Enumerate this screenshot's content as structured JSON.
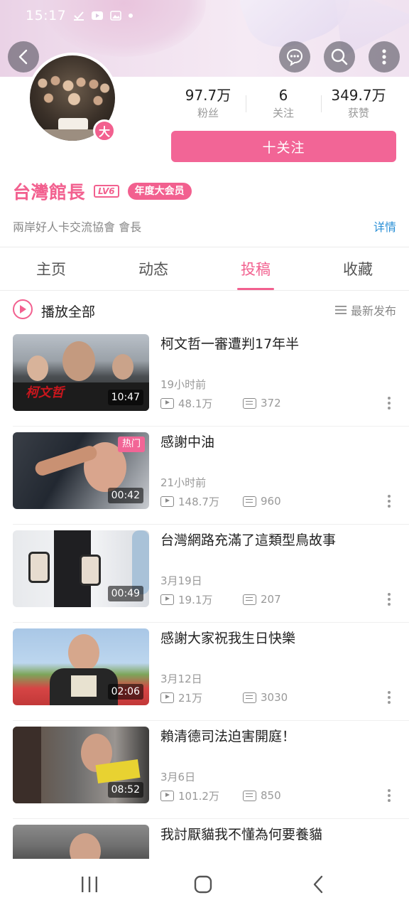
{
  "status_bar": {
    "time": "15:17"
  },
  "header": {
    "back_icon": "chevron-left-icon",
    "actions": [
      "chat-bubble-icon",
      "search-icon",
      "more-vertical-icon"
    ]
  },
  "profile": {
    "badge": "大",
    "name": "台灣館長",
    "level": "LV6",
    "vip_label": "年度大会员",
    "bio": "兩岸好人卡交流協會 會長",
    "detail_link": "详情",
    "follow_button": "十关注",
    "stats": [
      {
        "value": "97.7万",
        "label": "粉丝"
      },
      {
        "value": "6",
        "label": "关注"
      },
      {
        "value": "349.7万",
        "label": "获赞"
      }
    ]
  },
  "tabs": [
    {
      "label": "主页",
      "active": false
    },
    {
      "label": "动态",
      "active": false
    },
    {
      "label": "投稿",
      "active": true
    },
    {
      "label": "收藏",
      "active": false
    }
  ],
  "list_header": {
    "play_all": "播放全部",
    "sort": "最新发布"
  },
  "videos": [
    {
      "title": "柯文哲一審遭判17年半",
      "duration": "10:47",
      "date": "19小时前",
      "views": "48.1万",
      "comments": "372",
      "hot": ""
    },
    {
      "title": "感謝中油",
      "duration": "00:42",
      "date": "21小时前",
      "views": "148.7万",
      "comments": "960",
      "hot": "热门"
    },
    {
      "title": "台灣網路充滿了這類型鳥故事",
      "duration": "00:49",
      "date": "3月19日",
      "views": "19.1万",
      "comments": "207",
      "hot": ""
    },
    {
      "title": "感謝大家祝我生日快樂",
      "duration": "02:06",
      "date": "3月12日",
      "views": "21万",
      "comments": "3030",
      "hot": ""
    },
    {
      "title": "賴清德司法迫害開庭！",
      "duration": "08:52",
      "date": "3月6日",
      "views": "101.2万",
      "comments": "850",
      "hot": ""
    },
    {
      "title": "我討厭貓我不懂為何要養貓",
      "duration": "",
      "date": "",
      "views": "",
      "comments": "",
      "hot": ""
    }
  ],
  "nav_bar": [
    "recent-apps-icon",
    "home-icon",
    "back-icon"
  ],
  "colors": {
    "accent": "#f2608f",
    "link": "#2a8fd6"
  }
}
